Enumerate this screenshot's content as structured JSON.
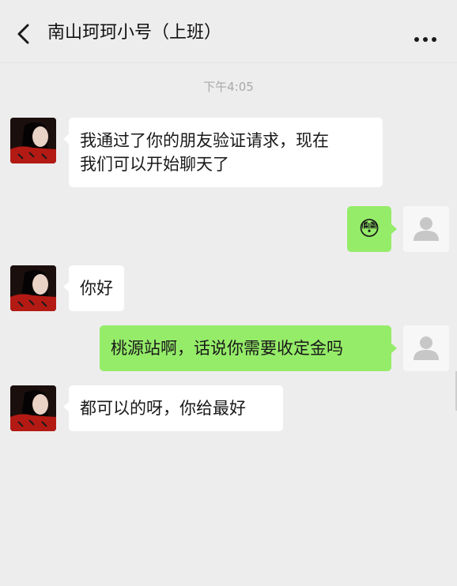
{
  "header": {
    "title": "南山珂珂小号（上班）",
    "back_icon": "chevron-left-icon",
    "more_icon": "more-horizontal-icon"
  },
  "timestamp": "下午4:05",
  "messages": [
    {
      "side": "left",
      "type": "text",
      "text_lines": [
        "我通过了你的朋友验证请求，现在",
        "我们可以开始聊天了"
      ]
    },
    {
      "side": "right",
      "type": "emoji",
      "emoji": "😳"
    },
    {
      "side": "left",
      "type": "text",
      "text": "你好"
    },
    {
      "side": "right",
      "type": "text",
      "text": "桃源站啊，话说你需要收定金吗"
    },
    {
      "side": "left",
      "type": "text",
      "text": "都可以的呀，你给最好"
    }
  ],
  "colors": {
    "background": "#ededed",
    "sent_bubble": "#95ec69",
    "received_bubble": "#ffffff",
    "timestamp": "#a8a8a8"
  }
}
